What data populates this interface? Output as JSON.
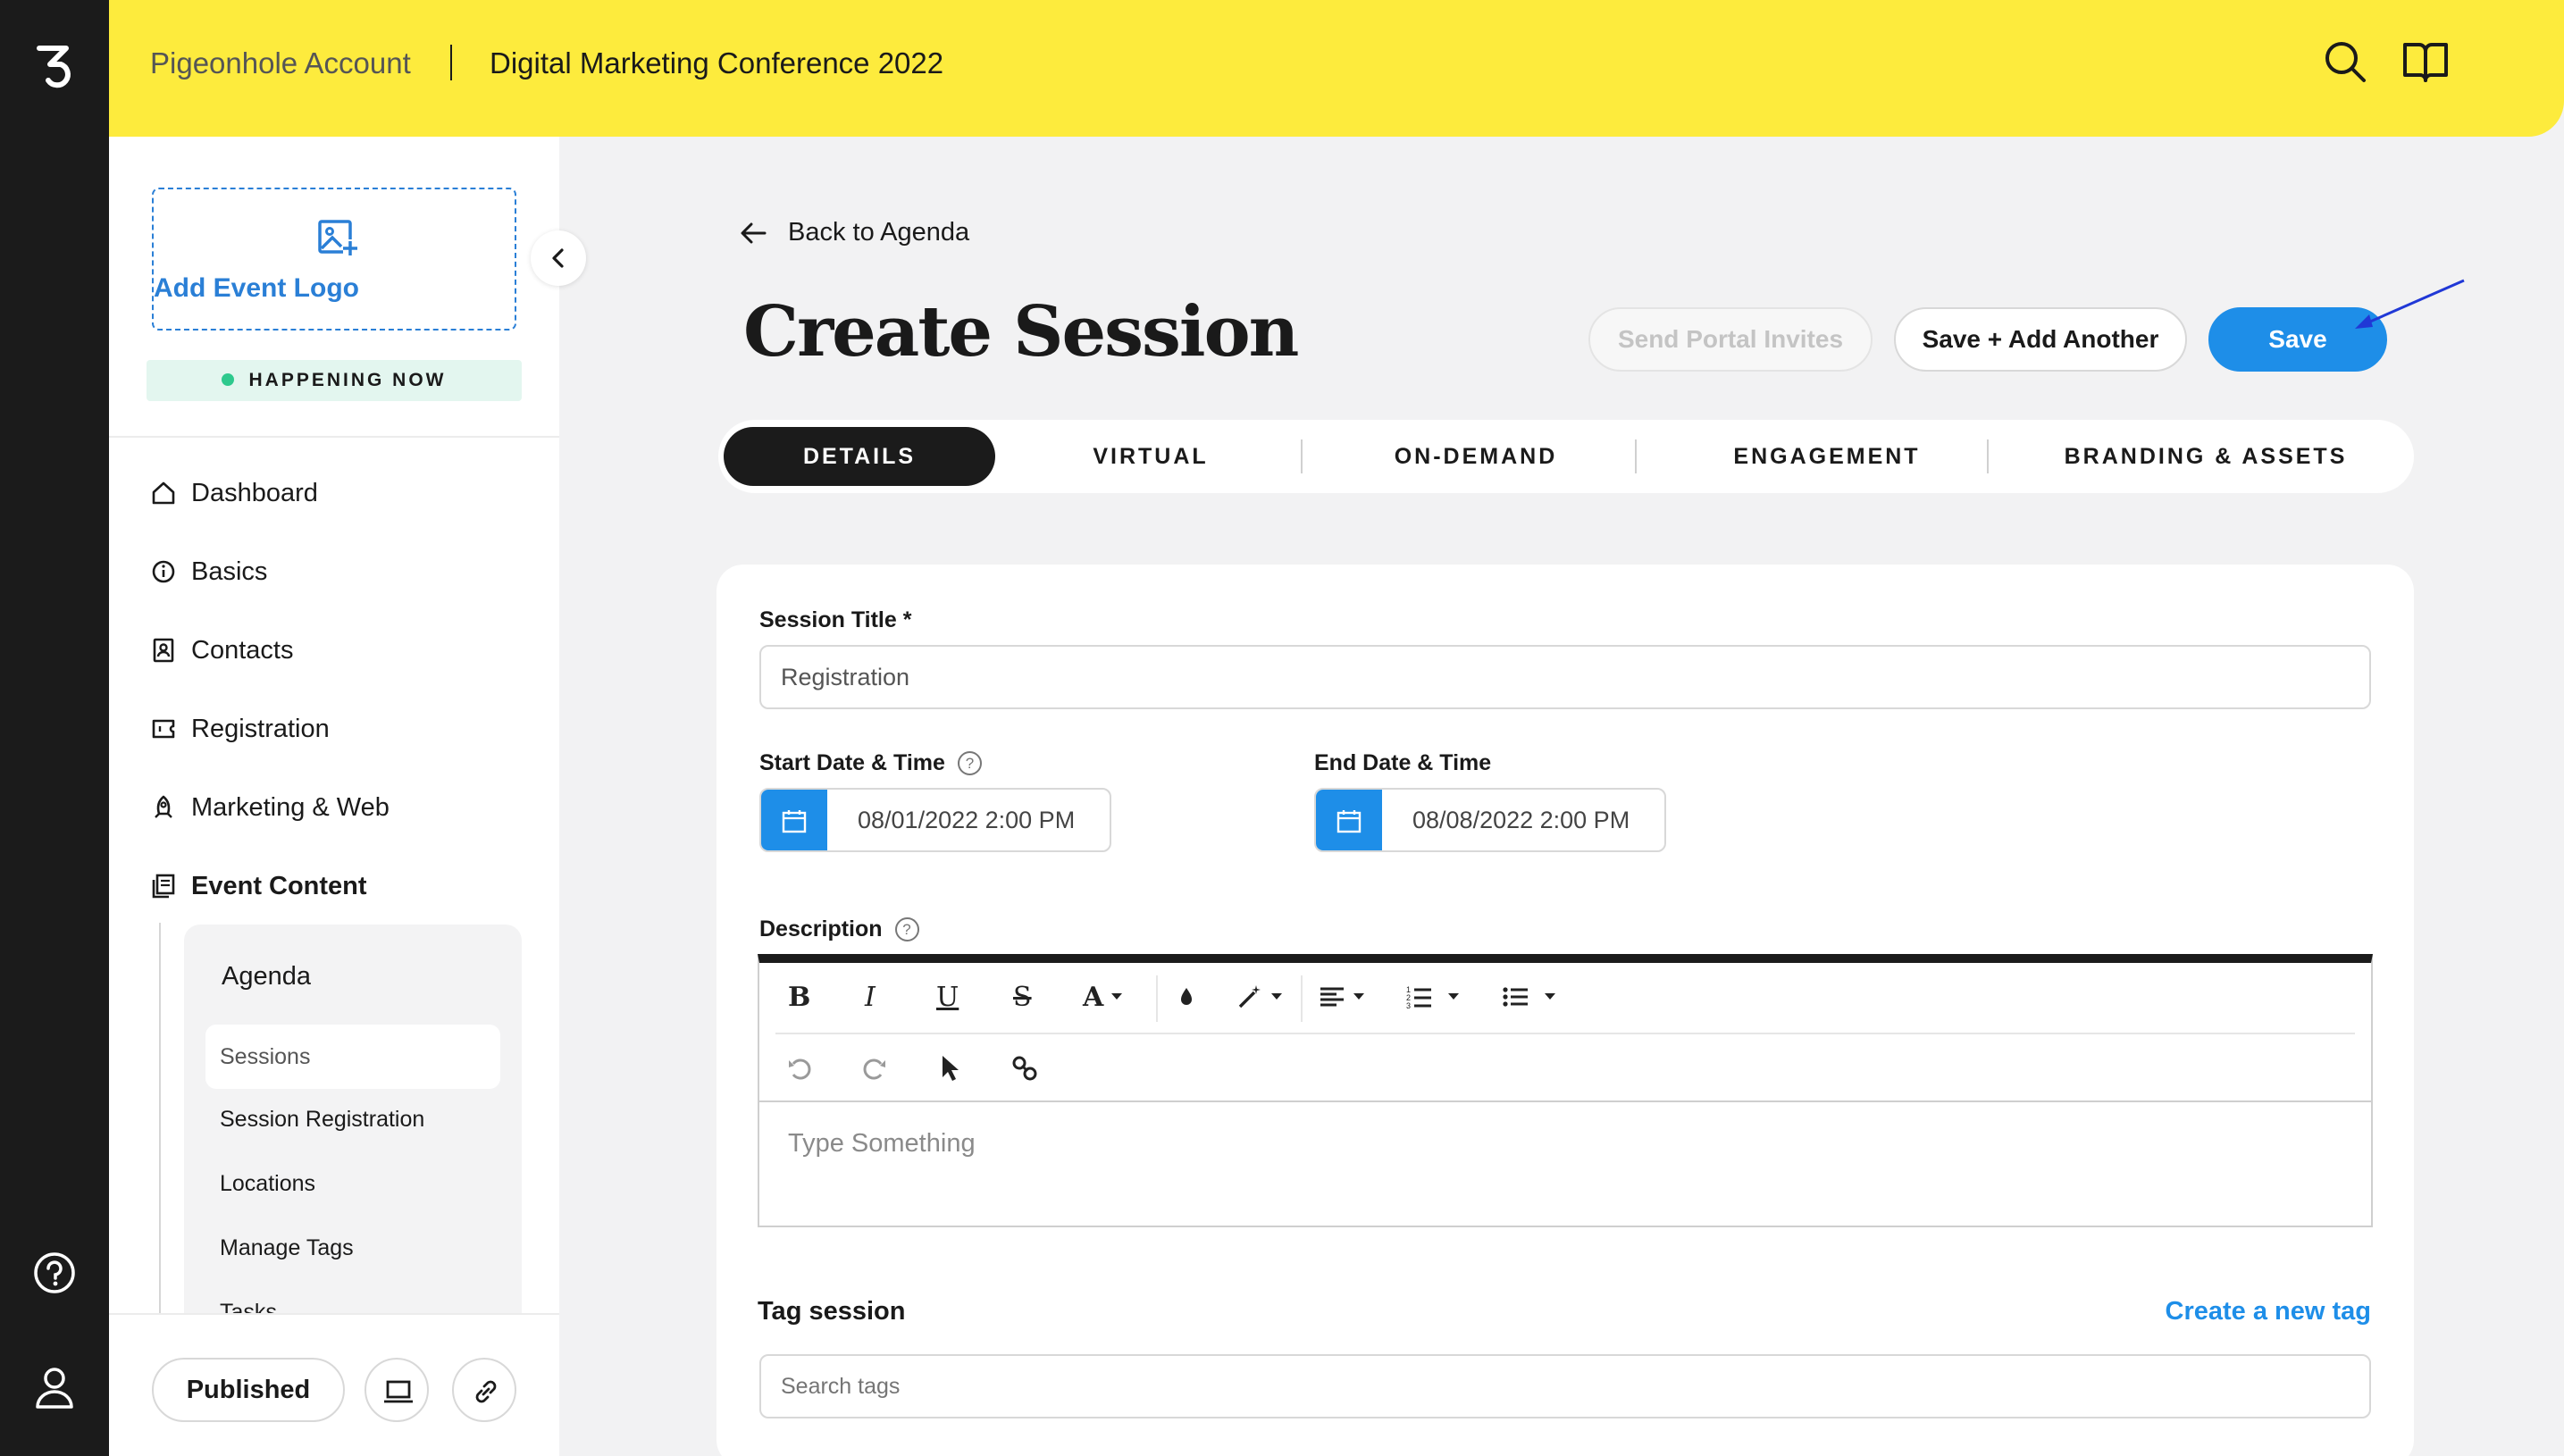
{
  "header": {
    "account": "Pigeonhole Account",
    "event_name": "Digital Marketing Conference 2022"
  },
  "sidebar": {
    "add_logo_label": "Add Event Logo",
    "status": "HAPPENING NOW",
    "nav": [
      {
        "label": "Dashboard",
        "icon": "home-icon"
      },
      {
        "label": "Basics",
        "icon": "info-icon"
      },
      {
        "label": "Contacts",
        "icon": "contact-icon"
      },
      {
        "label": "Registration",
        "icon": "ticket-icon"
      },
      {
        "label": "Marketing & Web",
        "icon": "rocket-icon"
      },
      {
        "label": "Event Content",
        "icon": "content-icon"
      }
    ],
    "submenu": {
      "heading": "Agenda",
      "items": [
        "Sessions",
        "Session Registration",
        "Locations",
        "Manage Tags",
        "Tasks"
      ],
      "selected": "Sessions"
    },
    "footer": {
      "published_label": "Published"
    }
  },
  "main": {
    "back_label": "Back to Agenda",
    "title": "Create Session",
    "buttons": {
      "send_invites": "Send Portal Invites",
      "save_another": "Save + Add Another",
      "save": "Save"
    },
    "tabs": [
      "DETAILS",
      "VIRTUAL",
      "ON-DEMAND",
      "ENGAGEMENT",
      "BRANDING & ASSETS"
    ],
    "active_tab": "DETAILS",
    "form": {
      "session_title_label": "Session Title *",
      "session_title_value": "Registration",
      "start_label": "Start Date & Time",
      "start_value": "08/01/2022 2:00 PM",
      "end_label": "End Date & Time",
      "end_value": "08/08/2022 2:00 PM",
      "description_label": "Description",
      "description_placeholder": "Type Something",
      "tag_label": "Tag session",
      "create_tag_link": "Create a new tag",
      "search_tags_placeholder": "Search tags"
    }
  },
  "colors": {
    "header_yellow": "#fdeb3d",
    "primary_blue": "#1e8ee8",
    "rail_dark": "#1b1b1b",
    "live_green": "#2ec98d"
  }
}
